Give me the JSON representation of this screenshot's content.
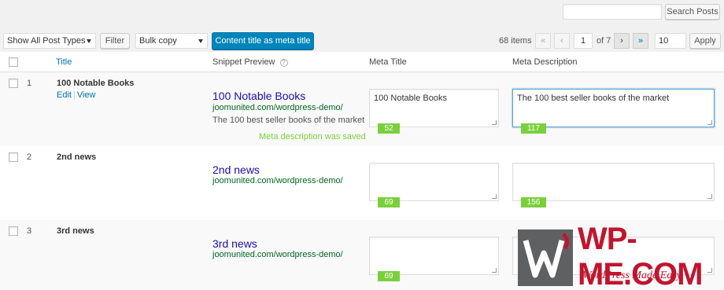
{
  "search": {
    "placeholder": "",
    "button": "Search Posts"
  },
  "filters": {
    "post_types": "Show All Post Types",
    "filter_button": "Filter",
    "bulk": "Bulk copy",
    "primary_action": "Content title as meta title"
  },
  "pagination": {
    "items": "68 items",
    "first": "«",
    "prev": "‹",
    "current": "1",
    "of": "of 7",
    "next": "›",
    "last": "»",
    "per_page": "10",
    "apply": "Apply"
  },
  "columns": {
    "title": "Title",
    "snippet": "Snippet Preview",
    "meta_title": "Meta Title",
    "meta_description": "Meta Description",
    "help_glyph": "?"
  },
  "rows": [
    {
      "num": "1",
      "title": "100 Notable Books",
      "actions": {
        "edit": "Edit",
        "sep": "|",
        "view": "View"
      },
      "snippet_title": "100 Notable Books",
      "snippet_url": "joomunited.com/wordpress-demo/",
      "snippet_desc": "The 100 best seller books of the market",
      "saved_msg": "Meta description was saved",
      "meta_title": "100 Notable Books",
      "meta_title_count": "52",
      "meta_desc": "The 100 best seller books of the market",
      "meta_desc_count": "117"
    },
    {
      "num": "2",
      "title": "2nd news",
      "snippet_title": "2nd news",
      "snippet_url": "joomunited.com/wordpress-demo/",
      "meta_title": "",
      "meta_title_count": "69",
      "meta_desc": "",
      "meta_desc_count": "156"
    },
    {
      "num": "3",
      "title": "3rd news",
      "snippet_title": "3rd news",
      "snippet_url": "joomunited.com/wordpress-demo/",
      "meta_title": "",
      "meta_title_count": "69",
      "meta_desc": "",
      "meta_desc_count": ""
    }
  ],
  "watermark": {
    "brand": "WP-ME.COM",
    "tagline": "WordPress Made Easy"
  },
  "colors": {
    "primary": "#0085ba",
    "counter": "#7ad03a",
    "link": "#0073aa",
    "snippet_title": "#1a0dab",
    "snippet_url": "#006621",
    "watermark": "#c0152f"
  }
}
